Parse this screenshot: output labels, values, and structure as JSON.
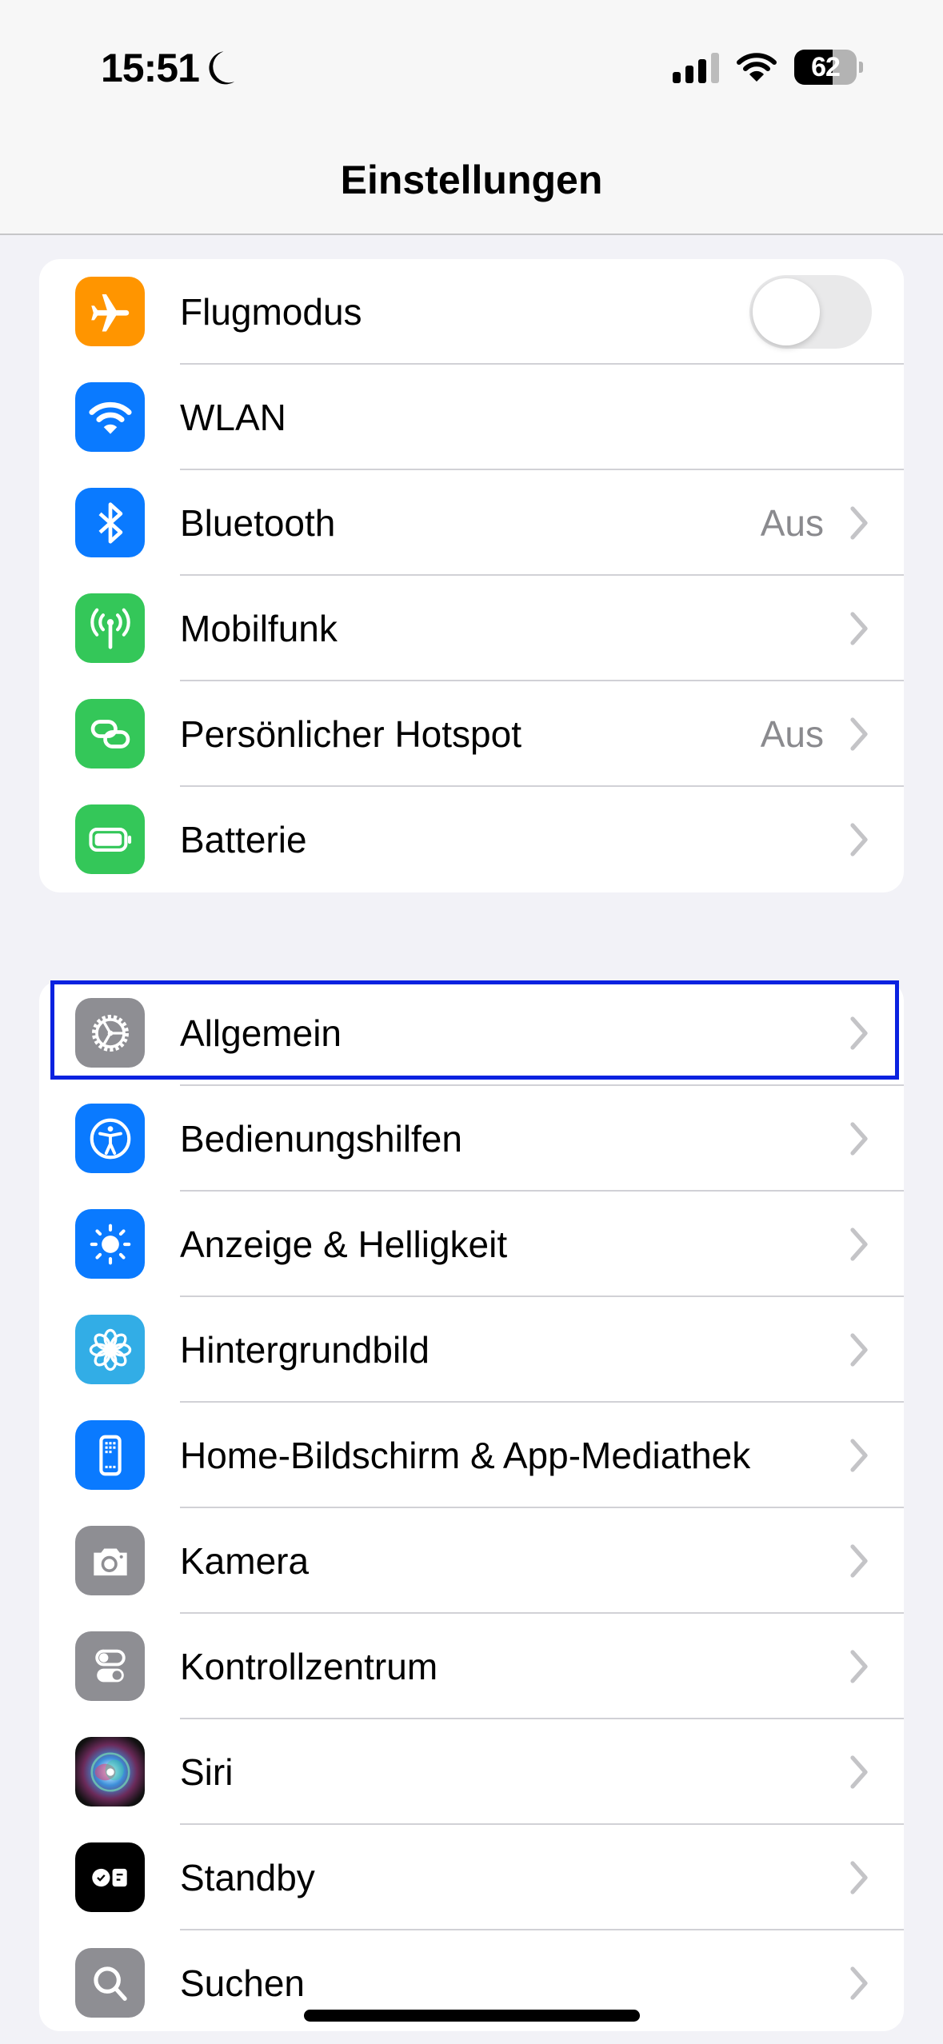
{
  "status_bar": {
    "time": "15:51",
    "focus_icon": "moon-icon",
    "signal_bars": 3,
    "signal_bars_total": 4,
    "battery_percent": "62",
    "battery_level": 0.62
  },
  "header": {
    "title": "Einstellungen"
  },
  "colors": {
    "orange": "#ff9500",
    "blue": "#0a7aff",
    "green": "#34c759",
    "gray": "#8e8e93",
    "light_blue": "#32ade6",
    "black": "#000000",
    "highlight": "#0a22e0"
  },
  "groups": [
    {
      "items": [
        {
          "label": "Flugmodus",
          "icon": "airplane-icon",
          "control": "toggle",
          "toggle_on": false
        },
        {
          "label": "WLAN",
          "icon": "wifi-icon"
        },
        {
          "label": "Bluetooth",
          "icon": "bluetooth-icon",
          "value": "Aus"
        },
        {
          "label": "Mobilfunk",
          "icon": "antenna-icon"
        },
        {
          "label": "Persönlicher Hotspot",
          "icon": "hotspot-link-icon",
          "value": "Aus"
        },
        {
          "label": "Batterie",
          "icon": "battery-icon"
        }
      ]
    },
    {
      "items": [
        {
          "label": "Allgemein",
          "icon": "gear-icon",
          "highlighted": true
        },
        {
          "label": "Bedienungshilfen",
          "icon": "accessibility-icon"
        },
        {
          "label": "Anzeige & Helligkeit",
          "icon": "sun-icon"
        },
        {
          "label": "Hintergrundbild",
          "icon": "flower-icon"
        },
        {
          "label": "Home-Bildschirm & App-Mediathek",
          "icon": "home-screen-icon"
        },
        {
          "label": "Kamera",
          "icon": "camera-icon"
        },
        {
          "label": "Kontrollzentrum",
          "icon": "switches-icon"
        },
        {
          "label": "Siri",
          "icon": "siri-icon"
        },
        {
          "label": "Standby",
          "icon": "standby-icon"
        },
        {
          "label": "Suchen",
          "icon": "search-icon"
        }
      ]
    }
  ]
}
